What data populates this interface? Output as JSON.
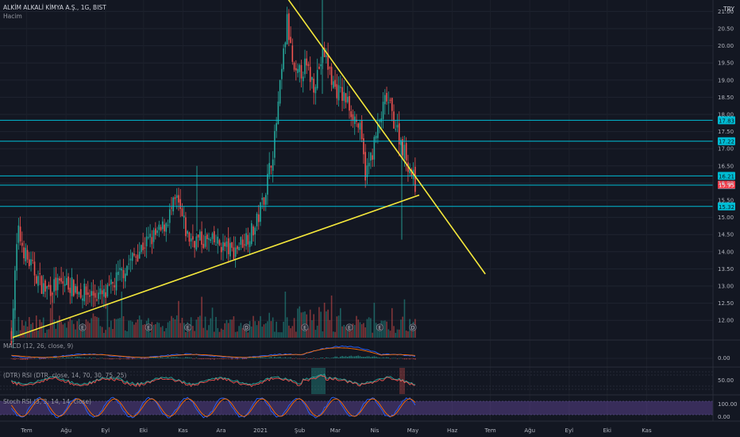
{
  "header": {
    "symbol_line": "ALKİM ALKALİ KİMYA A.Ş., 1G, BIST",
    "volume_label": "Hacim",
    "currency": "TRY"
  },
  "panes": {
    "macd_label": "MACD (12, 26, close, 9)",
    "dtr_label": "(DTR) RSI (DTR, close, 14, 70, 30, 75, 25)",
    "stoch_label": "Stoch RSI (3, 3, 14, 14, close)"
  },
  "colors": {
    "background": "#131722",
    "up": "#26a69a",
    "down": "#ef5350",
    "trendline": "#f5e83b",
    "level_line": "#00bcd4",
    "current_price": "#f23645",
    "macd": "#2962ff",
    "signal": "#ff6d00",
    "stoch_band": "#7e57c2"
  },
  "chart_data": {
    "type": "candlestick",
    "y_ticks": [
      "21.00",
      "20.50",
      "20.00",
      "19.50",
      "19.00",
      "18.50",
      "18.00",
      "17.50",
      "17.00",
      "16.50",
      "16.00",
      "15.50",
      "15.00",
      "14.50",
      "14.00",
      "13.50",
      "13.00",
      "12.50",
      "12.00"
    ],
    "x_ticks": [
      "Tem",
      "Ağu",
      "Eyl",
      "Eki",
      "Kas",
      "Ara",
      "2021",
      "Şub",
      "Mar",
      "Nis",
      "May",
      "Haz",
      "Tem",
      "Ağu",
      "Eyl",
      "Eki",
      "Kas"
    ],
    "horizontal_levels": [
      {
        "value": 17.83,
        "label": "17.83"
      },
      {
        "value": 17.22,
        "label": "17.22"
      },
      {
        "value": 16.21,
        "label": "16.21"
      },
      {
        "value": 15.94,
        "label": "15.94"
      },
      {
        "value": 15.32,
        "label": "15.32"
      }
    ],
    "current_price": {
      "value": 15.95,
      "label": "15.95"
    },
    "trendlines": [
      {
        "from": {
          "date": "2020-06-20",
          "price": 11.5
        },
        "to": {
          "date": "2021-05-06",
          "price": 15.65
        }
      },
      {
        "from": {
          "date": "2021-01-20",
          "price": 21.5
        },
        "to": {
          "date": "2021-06-27",
          "price": 13.35
        }
      }
    ],
    "price_path": [
      {
        "date": "2020-06-19",
        "price": 11.6
      },
      {
        "date": "2020-06-24",
        "price": 14.6
      },
      {
        "date": "2020-07-01",
        "price": 13.8
      },
      {
        "date": "2020-07-15",
        "price": 12.9
      },
      {
        "date": "2020-08-01",
        "price": 13.1
      },
      {
        "date": "2020-08-15",
        "price": 12.8
      },
      {
        "date": "2020-09-01",
        "price": 12.7
      },
      {
        "date": "2020-09-10",
        "price": 13.2
      },
      {
        "date": "2020-09-20",
        "price": 13.7
      },
      {
        "date": "2020-10-01",
        "price": 14.2
      },
      {
        "date": "2020-10-15",
        "price": 14.6
      },
      {
        "date": "2020-10-27",
        "price": 15.5
      },
      {
        "date": "2020-11-05",
        "price": 14.4
      },
      {
        "date": "2020-11-20",
        "price": 14.3
      },
      {
        "date": "2020-12-01",
        "price": 14.2
      },
      {
        "date": "2020-12-10",
        "price": 14.0
      },
      {
        "date": "2020-12-20",
        "price": 14.4
      },
      {
        "date": "2020-12-28",
        "price": 14.7
      },
      {
        "date": "2021-01-05",
        "price": 15.8
      },
      {
        "date": "2021-01-12",
        "price": 17.2
      },
      {
        "date": "2021-01-18",
        "price": 19.3
      },
      {
        "date": "2021-01-22",
        "price": 20.7
      },
      {
        "date": "2021-01-28",
        "price": 19.0
      },
      {
        "date": "2021-02-05",
        "price": 19.4
      },
      {
        "date": "2021-02-12",
        "price": 18.9
      },
      {
        "date": "2021-02-20",
        "price": 19.8
      },
      {
        "date": "2021-02-28",
        "price": 18.8
      },
      {
        "date": "2021-03-10",
        "price": 18.4
      },
      {
        "date": "2021-03-20",
        "price": 17.6
      },
      {
        "date": "2021-03-25",
        "price": 16.2
      },
      {
        "date": "2021-04-01",
        "price": 17.2
      },
      {
        "date": "2021-04-10",
        "price": 18.5
      },
      {
        "date": "2021-04-20",
        "price": 17.4
      },
      {
        "date": "2021-04-28",
        "price": 16.5
      },
      {
        "date": "2021-05-03",
        "price": 15.95
      }
    ],
    "events": [
      {
        "date": "2020-08-14",
        "label": "E"
      },
      {
        "date": "2020-10-05",
        "label": "E"
      },
      {
        "date": "2020-11-05",
        "label": "E"
      },
      {
        "date": "2020-12-21",
        "label": "D"
      },
      {
        "date": "2021-02-05",
        "label": "E"
      },
      {
        "date": "2021-03-12",
        "label": "E"
      },
      {
        "date": "2021-04-05",
        "label": "E"
      },
      {
        "date": "2021-05-01",
        "label": "D"
      }
    ],
    "macd": {
      "axis_labels": [
        "0.00"
      ],
      "zero": 0
    },
    "rsi": {
      "axis_labels": [
        "50.00"
      ],
      "bands": [
        75,
        70,
        30,
        25
      ]
    },
    "stoch_rsi": {
      "axis_labels": [
        "100.00",
        "0.00"
      ],
      "band": [
        20,
        80
      ]
    }
  }
}
